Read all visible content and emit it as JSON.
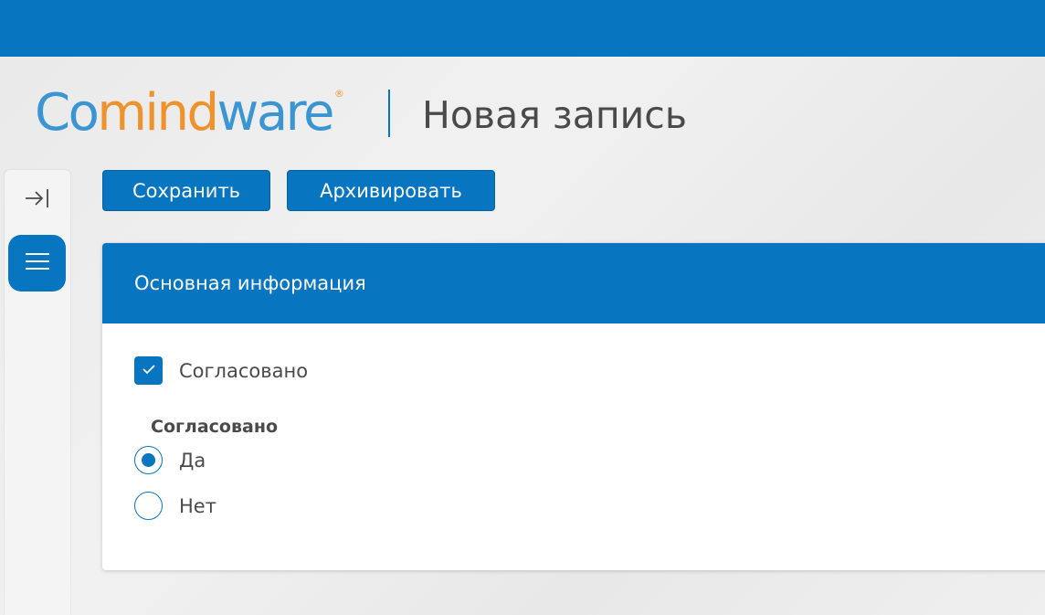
{
  "header": {
    "brand_part1": "Co",
    "brand_part2": "mind",
    "brand_part3": "ware",
    "brand_registered": "®",
    "page_title": "Новая запись"
  },
  "colors": {
    "primary": "#0875c1",
    "brand_blue": "#3a95d2",
    "brand_orange": "#f0922c"
  },
  "side_rail": {
    "expand_icon": "expand-panel-icon",
    "menu_icon": "menu-icon"
  },
  "toolbar": {
    "save_label": "Сохранить",
    "archive_label": "Архивировать"
  },
  "form": {
    "section_title": "Основная информация",
    "checkbox": {
      "label": "Согласовано",
      "checked": true
    },
    "radio_group": {
      "label": "Согласовано",
      "options": [
        {
          "label": "Да",
          "selected": true
        },
        {
          "label": "Нет",
          "selected": false
        }
      ]
    }
  }
}
